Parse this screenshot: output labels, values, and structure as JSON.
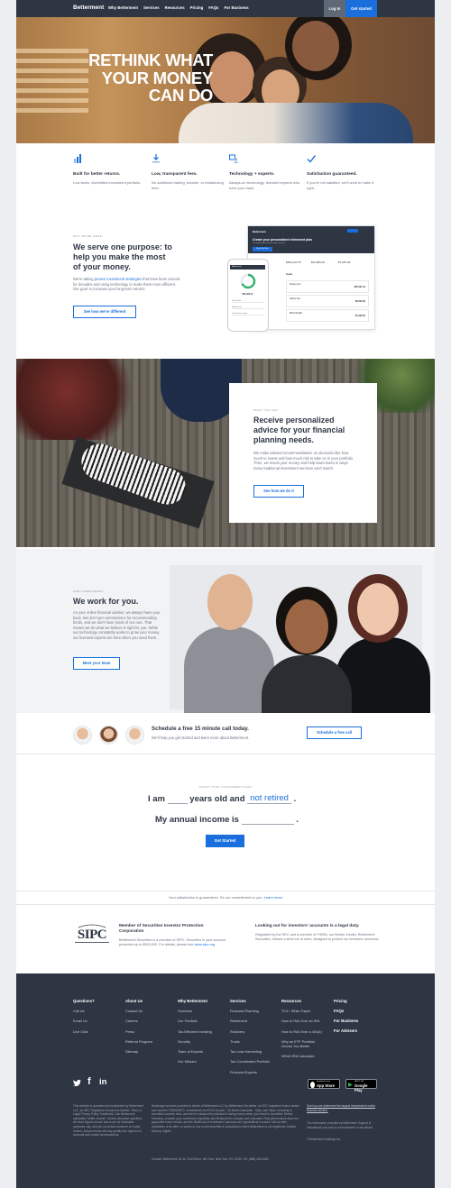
{
  "nav": {
    "brand": "Betterment",
    "links": [
      "Why Betterment",
      "Services",
      "Resources",
      "Pricing",
      "FAQs",
      "For Business"
    ],
    "login": "Log In",
    "get_started": "Get started"
  },
  "hero": {
    "line1": "RETHINK WHAT",
    "line2": "YOUR MONEY",
    "line3": "CAN DO"
  },
  "features": [
    {
      "icon": "bar-chart-icon",
      "title": "Built for better returns.",
      "desc": "Low taxes, diversified investment portfolio."
    },
    {
      "icon": "low-fee-icon",
      "title": "Low, transparent fees.",
      "desc": "No additional trading, transfer, or rebalancing fees."
    },
    {
      "icon": "technology-experts-icon",
      "title": "Technology + experts.",
      "desc": "Always-on technology, licensed experts who have your back."
    },
    {
      "icon": "checkmark-icon",
      "title": "Satisfaction guaranteed.",
      "desc": "If you're not satisfied, we'll work to make it right."
    }
  ],
  "purpose": {
    "eyebrow": "WHY WE'RE HERE",
    "heading": "We serve one purpose: to help you make the most of your money.",
    "body_pre": "We're taking ",
    "body_link": "proven investment strategies",
    "body_post": " that have been around for decades and using technology to make them more efficient. Our goal: to increase your long-term returns.",
    "button": "See how we're different"
  },
  "dashboard": {
    "brand": "Betterment",
    "title": "Create your personalized retirement plan",
    "subtitle": "Customize your plan to retire on time",
    "button": "Build My Plan",
    "stats": [
      "$350,133.76",
      "$23,083.00",
      "$7,587.00"
    ],
    "tab": "Goals",
    "rows": [
      {
        "name": "Retirement",
        "value": "$25,091.44"
      },
      {
        "name": "Safety Net",
        "value": "$6,500.00"
      },
      {
        "name": "Build Wealth",
        "value": "$1,460.00"
      }
    ]
  },
  "phone": {
    "brand": "Betterment",
    "total": "$95,483.12",
    "rows": [
      "Safety Net",
      "Retirement",
      "General Investing"
    ]
  },
  "advice": {
    "eyebrow": "WHAT YOU GET",
    "heading": "Receive personalized advice for your financial planning needs.",
    "body": "We make tailored recommendations on decisions like how much to invest and how much risk to take on in your portfolio. Then, we invest your money and help lower taxes in ways many traditional investment services can't match.",
    "button": "See how we do it"
  },
  "work": {
    "eyebrow": "OUR COMMITMENT",
    "heading": "We work for you.",
    "body": "As your online financial adviser, we always have your back. We don't get commissions for recommending funds, and we don't have funds of our own. That means we do what we believe is right for you. While our technology constantly works to grow your money, our licensed experts are here when you need them.",
    "button": "Meet your team"
  },
  "schedule": {
    "heading": "Schedule a free 15 minute call today.",
    "body": "We'll help you get started and learn more about Betterment.",
    "button": "Schedule a free call"
  },
  "plan": {
    "eyebrow": "START YOUR INVESTMENT PLAN",
    "i_am": "I am",
    "years_old_and": "years old and",
    "retired_value": "not retired",
    "period": ".",
    "income_label": "My annual income is",
    "button": "Get Started"
  },
  "guarantee": {
    "text": "Your satisfaction is guaranteed. It's our commitment to you.",
    "link": "Learn more"
  },
  "sipc": {
    "logo": "SIPC",
    "heading": "Member of Securities Investor Protection Corporation",
    "body": "Betterment Securities is a member of SIPC. Securities in your account protected up to $500,000. For details, please see",
    "link": "www.sipc.org."
  },
  "finra": {
    "heading": "Looking out for investors' accounts is a legal duty.",
    "body": "Regulated by the SEC and a member of FINRA, our Broker-Dealer, Betterment Securities, follows a strict set of rules, designed to protect our investors' accounts."
  },
  "footer": {
    "columns": [
      {
        "heading": "Questions?",
        "items": [
          "Call Us",
          "Email Us",
          "Live Chat"
        ]
      },
      {
        "heading": "About Us",
        "items": [
          "Contact Us",
          "Careers",
          "Press",
          "Referral Program",
          "Sitemap"
        ]
      },
      {
        "heading": "Why Betterment",
        "items": [
          "Overview",
          "Our Portfolio",
          "Tax-Efficient Investing",
          "Security",
          "Team of Experts",
          "Our Mission"
        ]
      },
      {
        "heading": "Services",
        "items": [
          "Financial Planning",
          "Retirement",
          "Rollovers",
          "Trusts",
          "Tax Loss Harvesting",
          "Tax-Coordinated Portfolio",
          "Financial Experts"
        ]
      },
      {
        "heading": "Resources",
        "items": [
          "TLH+ White Paper",
          "How to Roll Over an IRA",
          "How to Roll Over a 401(k)",
          "Why an ETF Portfolio Serves You Better",
          "Which IRA Calculator"
        ]
      },
      {
        "heading": "Pricing",
        "items": [
          "FAQs",
          "For Business",
          "For Advisers"
        ]
      }
    ],
    "app_store": {
      "small": "Download on the",
      "big": "App Store"
    },
    "google_play": {
      "small": "GET IT ON",
      "big": "Google Play"
    },
    "legal1": "This website is operated and maintained by Betterment LLC, an SEC Registered Investment Adviser. Terms & Legal Privacy Policy Trademark. Use Betterment calculates \"better returns\". Unless otherwise specified, all return figures shown above are for illustrative purposes only, and are not actual customer or model returns. Actual returns will vary greatly and depend on personal and market circumstances.",
    "legal2": "Brokerage services provided to clients of Betterment LLC by Betterment Securities, an SEC registered broker-dealer and member FINRA/SIPC. Investments Not FDIC Insured · No Bank Guarantee · May Lose Value. Investing in securities involves risks, and there is always the potential of losing money when you invest in securities. Before investing, consider your investment objectives and Betterment's charges and expenses. Past performance does not guarantee future results, and the likelihood of investment outcomes are hypothetical in nature. Not an offer, solicitation of an offer, or advice to buy or sell securities in jurisdictions where Betterment is not registered. Market Data by Xignite.",
    "address": "Contact: Betterment, 61 W. 23rd Street, 4th Floor, New York, NY 10010. Tel: (888) 428-9482.",
    "legal3": "See how we determine the largest independent online financial adviser.",
    "legal4": "The information provided by Betterment Support is educational only and is not investment or tax advice.",
    "copyright": "© Betterment Holdings Inc."
  }
}
